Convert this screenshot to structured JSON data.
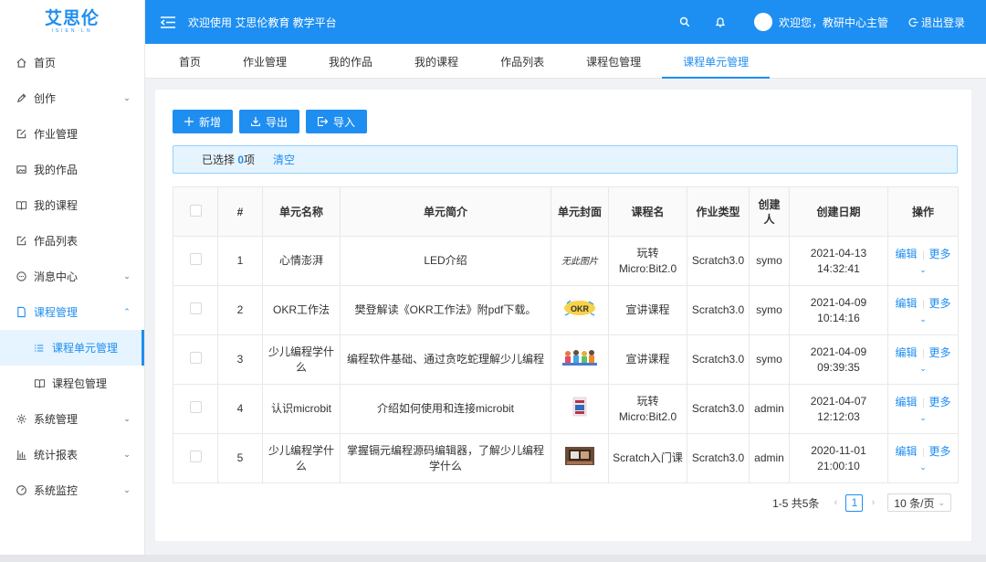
{
  "logo": {
    "main": "艾思伦",
    "sub": "ISIEN·LN",
    "color": "#1f8ef1"
  },
  "header": {
    "welcome": "欢迎使用 艾思伦教育 教学平台",
    "user_text": "欢迎您，教研中心主管",
    "logout": "退出登录",
    "bg_color": "#1e8ff2"
  },
  "sidebar": {
    "items": [
      {
        "label": "首页",
        "icon": "home-icon"
      },
      {
        "label": "创作",
        "icon": "pen-icon",
        "arrow": "down"
      },
      {
        "label": "作业管理",
        "icon": "edit-icon"
      },
      {
        "label": "我的作品",
        "icon": "picture-icon"
      },
      {
        "label": "我的课程",
        "icon": "book-icon"
      },
      {
        "label": "作品列表",
        "icon": "edit-icon"
      },
      {
        "label": "消息中心",
        "icon": "message-icon",
        "arrow": "down"
      },
      {
        "label": "课程管理",
        "icon": "document-icon",
        "arrow": "up"
      },
      {
        "label": "课程单元管理",
        "icon": "list-icon"
      },
      {
        "label": "课程包管理",
        "icon": "book-icon"
      },
      {
        "label": "系统管理",
        "icon": "gear-icon",
        "arrow": "down"
      },
      {
        "label": "统计报表",
        "icon": "bar-chart-icon",
        "arrow": "down"
      },
      {
        "label": "系统监控",
        "icon": "dashboard-icon",
        "arrow": "down"
      }
    ]
  },
  "tabs": [
    "首页",
    "作业管理",
    "我的作品",
    "我的课程",
    "作品列表",
    "课程包管理",
    "课程单元管理"
  ],
  "toolbar": {
    "add": "新增",
    "export": "导出",
    "import": "导入"
  },
  "alert": {
    "prefix": "已选择 ",
    "count": "0",
    "suffix": "项",
    "clear": "清空"
  },
  "table": {
    "headers": [
      "#",
      "单元名称",
      "单元简介",
      "单元封面",
      "课程名",
      "作业类型",
      "创建人",
      "创建日期",
      "操作"
    ],
    "rows": [
      {
        "no": "1",
        "name": "心情澎湃",
        "intro": "LED介绍",
        "cover": "无此图片",
        "course": "玩转Micro:Bit2.0",
        "type": "Scratch3.0",
        "creator": "symo",
        "date": "2021-04-13 14:32:41"
      },
      {
        "no": "2",
        "name": "OKR工作法",
        "intro": "樊登解读《OKR工作法》附pdf下载。",
        "cover": "OKR",
        "course": "宣讲课程",
        "type": "Scratch3.0",
        "creator": "symo",
        "date": "2021-04-09 10:14:16"
      },
      {
        "no": "3",
        "name": "少儿编程学什么",
        "intro": "编程软件基础、通过贪吃蛇理解少儿编程",
        "cover": "",
        "course": "宣讲课程",
        "type": "Scratch3.0",
        "creator": "symo",
        "date": "2021-04-09 09:39:35"
      },
      {
        "no": "4",
        "name": "认识microbit",
        "intro": "介绍如何使用和连接microbit",
        "cover": "",
        "course": "玩转Micro:Bit2.0",
        "type": "Scratch3.0",
        "creator": "admin",
        "date": "2021-04-07 12:12:03"
      },
      {
        "no": "5",
        "name": "少儿编程学什么",
        "intro": "掌握镉元编程源码编辑器，了解少儿编程学什么",
        "cover": "",
        "course": "Scratch入门课",
        "type": "Scratch3.0",
        "creator": "admin",
        "date": "2020-11-01 21:00:10"
      }
    ],
    "op_edit": "编辑",
    "op_more": "更多"
  },
  "pager": {
    "total": "1-5 共5条",
    "current": "1",
    "page_size": "10 条/页"
  }
}
